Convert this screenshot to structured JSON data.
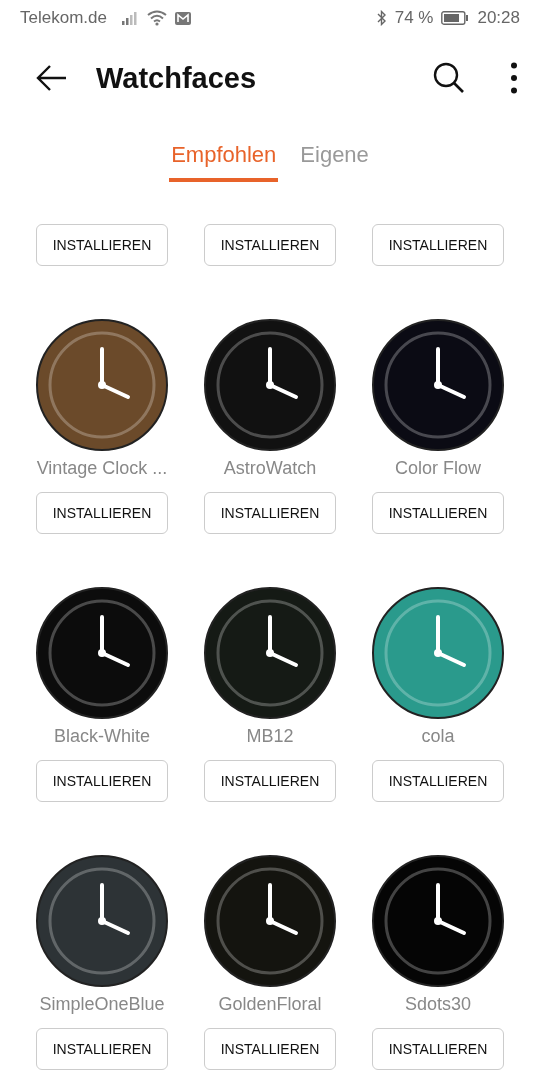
{
  "status_bar": {
    "carrier": "Telekom.de",
    "battery_percent": "74 %",
    "time": "20:28"
  },
  "header": {
    "title": "Watchfaces"
  },
  "tabs": [
    {
      "label": "Empfohlen",
      "selected": true
    },
    {
      "label": "Eigene",
      "selected": false
    }
  ],
  "watchfaces": [
    {
      "kind": "button_only",
      "button": "INSTALLIEREN"
    },
    {
      "kind": "button_only",
      "button": "INSTALLIEREN"
    },
    {
      "kind": "button_only",
      "button": "INSTALLIEREN"
    },
    {
      "kind": "full",
      "name": "Vintage Clock ...",
      "button": "INSTALLIEREN"
    },
    {
      "kind": "full",
      "name": "AstroWatch",
      "button": "INSTALLIEREN"
    },
    {
      "kind": "full",
      "name": "Color Flow",
      "button": "INSTALLIEREN"
    },
    {
      "kind": "full",
      "name": "Black-White",
      "button": "INSTALLIEREN"
    },
    {
      "kind": "full",
      "name": "MB12",
      "button": "INSTALLIEREN"
    },
    {
      "kind": "full",
      "name": "cola",
      "button": "INSTALLIEREN"
    },
    {
      "kind": "full",
      "name": "SimpleOneBlue",
      "button": "INSTALLIEREN"
    },
    {
      "kind": "full",
      "name": "GoldenFloral",
      "button": "INSTALLIEREN"
    },
    {
      "kind": "full",
      "name": "Sdots30",
      "button": "INSTALLIEREN"
    }
  ]
}
